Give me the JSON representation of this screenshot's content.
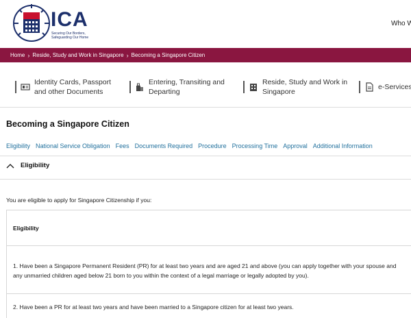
{
  "header": {
    "logo_text": "ICA",
    "logo_tagline": "Securing Our Borders, Safeguarding Our Home",
    "who_link": "Who W"
  },
  "breadcrumb": [
    "Home",
    "Reside, Study and Work in Singapore",
    "Becoming a Singapore Citizen"
  ],
  "categories": [
    {
      "label_line1": "Identity Cards, Passport",
      "label_line2": "and other Documents",
      "icon": "id-card-icon"
    },
    {
      "label_line1": "Entering, Transiting and",
      "label_line2": "Departing",
      "icon": "luggage-icon"
    },
    {
      "label_line1": "Reside, Study and Work in",
      "label_line2": "Singapore",
      "icon": "building-icon"
    },
    {
      "label_line1": "e-Services a",
      "label_line2": "",
      "icon": "document-icon"
    }
  ],
  "page_title": "Becoming a Singapore Citizen",
  "tabs": [
    "Eligibility",
    "National Service Obligation",
    "Fees",
    "Documents Required",
    "Procedure",
    "Processing Time",
    "Approval",
    "Additional Information"
  ],
  "accordion": {
    "title": "Eligibility",
    "state": "expanded"
  },
  "intro": "You are eligible to apply for Singapore Citizenship if you:",
  "table": {
    "header": "Eligibility",
    "rows": [
      "1. Have been a Singapore Permanent Resident (PR) for at least two years and are aged 21 and above (you can apply together with your spouse and any unmarried children aged below 21 born to you within the context of a legal marriage or legally adopted by you).",
      "2. Have been a PR for at least two years and have been married to a Singapore citizen for at least two years."
    ]
  },
  "colors": {
    "brand_maroon": "#8a1640",
    "link_blue": "#1f6f9c",
    "logo_navy": "#1c2f6b"
  }
}
